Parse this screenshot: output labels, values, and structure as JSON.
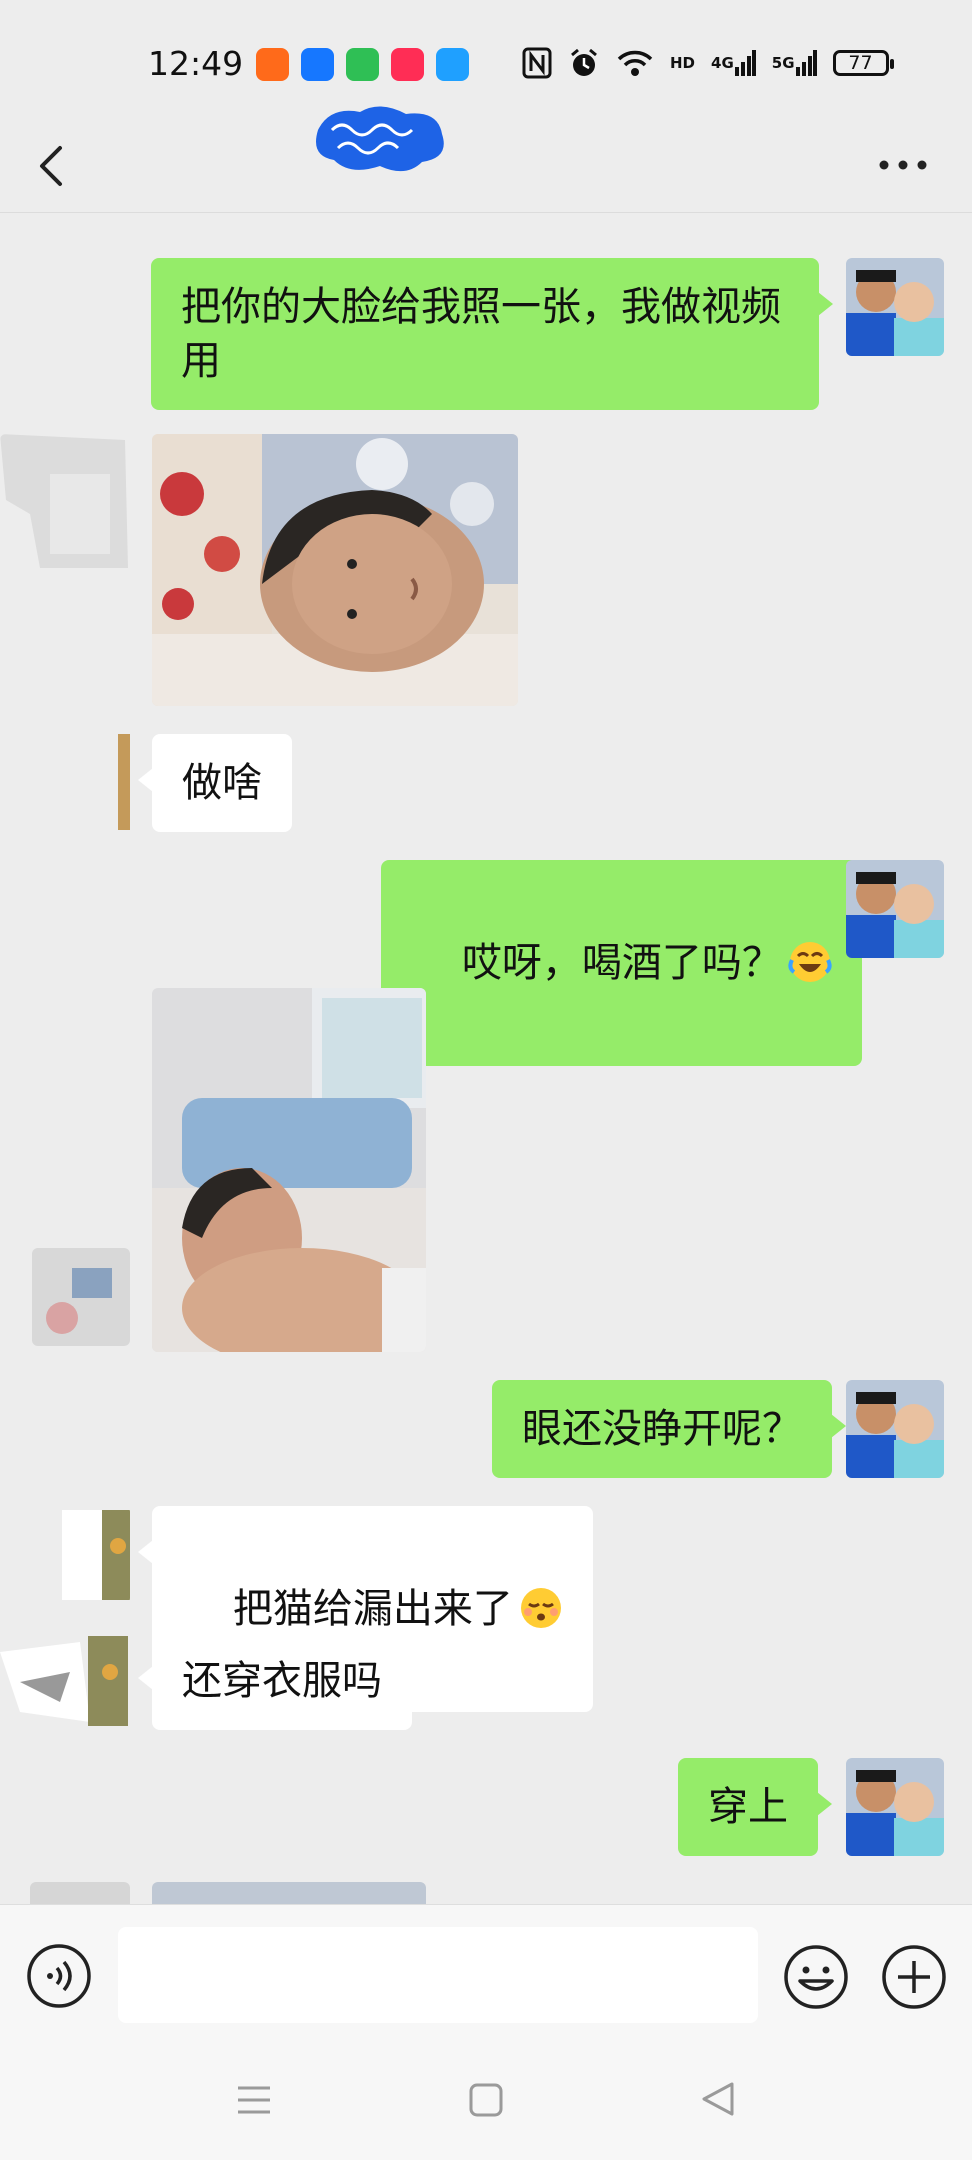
{
  "status_bar": {
    "time": "12:49",
    "app_icons": [
      {
        "name": "taobao-app-icon",
        "color": "#ff6a1a"
      },
      {
        "name": "alipay-app-icon",
        "color": "#1677ff"
      },
      {
        "name": "chat-app-icon",
        "color": "#2fbf55"
      },
      {
        "name": "video-app-icon",
        "color": "#ff2d55"
      },
      {
        "name": "navigation-app-icon",
        "color": "#1fa0ff"
      }
    ],
    "network_labels": [
      "HD",
      "4G",
      "5G"
    ],
    "battery": "77"
  },
  "header": {
    "title": "",
    "back_icon": "back-chevron-icon",
    "more_icon": "more-dots-icon"
  },
  "messages": [
    {
      "side": "out",
      "type": "text",
      "text": "把你的大脸给我照一张，我做视频\n用"
    },
    {
      "side": "in",
      "type": "image",
      "description": ""
    },
    {
      "side": "in",
      "type": "text",
      "text": "做啥"
    },
    {
      "side": "out",
      "type": "text",
      "text": "哎呀，喝酒了吗？",
      "emoji": "tears-of-joy-emoji"
    },
    {
      "side": "in",
      "type": "image"
    },
    {
      "side": "out",
      "type": "text",
      "text": "眼还没睁开呢？"
    },
    {
      "side": "in",
      "type": "text",
      "text": "把猫给漏出来了",
      "emoji": "kissing-emoji"
    },
    {
      "side": "in",
      "type": "text",
      "text": "还穿衣服吗"
    },
    {
      "side": "out",
      "type": "text",
      "text": "穿上"
    },
    {
      "side": "in",
      "type": "image"
    }
  ],
  "input_bar": {
    "placeholder": "",
    "voice_icon": "voice-input-icon",
    "emoji_icon": "emoji-icon",
    "plus_icon": "plus-icon"
  },
  "nav_bar": {
    "icons": [
      "menu-icon",
      "home-icon",
      "back-triangle-icon"
    ]
  },
  "colors": {
    "background": "#ededed",
    "outgoing_bubble": "#95ec69",
    "incoming_bubble": "#ffffff"
  }
}
